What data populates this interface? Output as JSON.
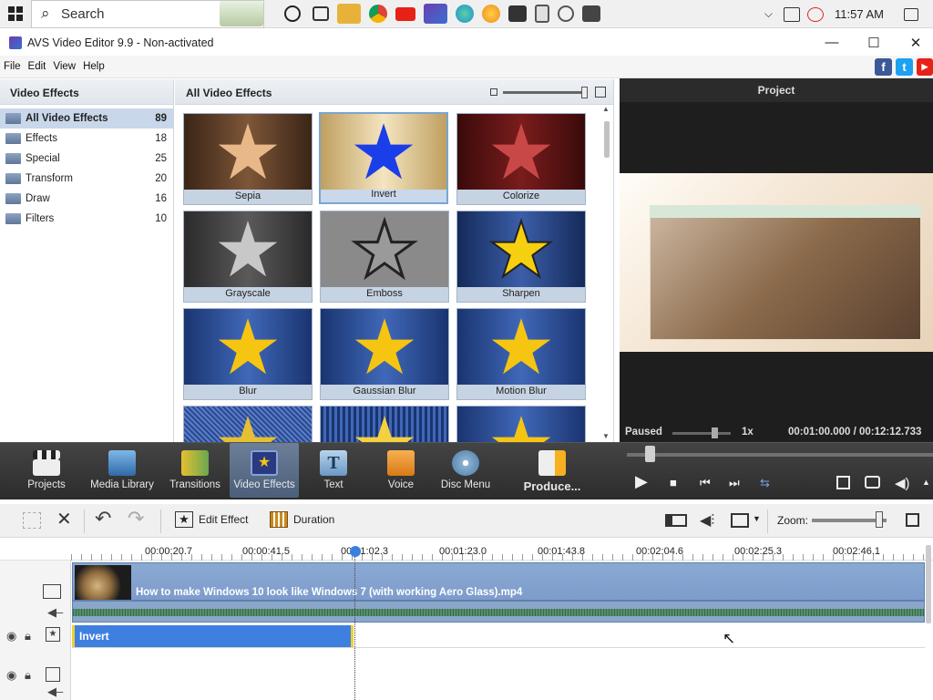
{
  "taskbar": {
    "search_placeholder": "Search",
    "time": "11:57 AM",
    "colors": {
      "youtube": "#e62117",
      "chrome": "#e9b21d",
      "edge": "#1f8fd8",
      "firefox": "#f08a24"
    }
  },
  "window": {
    "title": "AVS Video Editor 9.9 - Non-activated",
    "minimize": "—",
    "maximize": "☐",
    "close": "✕"
  },
  "menu": [
    "File",
    "Edit",
    "View",
    "Help"
  ],
  "social": {
    "facebook": "f",
    "twitter": "t",
    "youtube": "▶"
  },
  "categories": {
    "header": "Video Effects",
    "items": [
      {
        "label": "All Video Effects",
        "count": "89"
      },
      {
        "label": "Effects",
        "count": "18"
      },
      {
        "label": "Special",
        "count": "25"
      },
      {
        "label": "Transform",
        "count": "20"
      },
      {
        "label": "Draw",
        "count": "16"
      },
      {
        "label": "Filters",
        "count": "10"
      }
    ]
  },
  "grid": {
    "header": "All Video Effects",
    "tiles": [
      {
        "label": "Sepia"
      },
      {
        "label": "Invert"
      },
      {
        "label": "Colorize"
      },
      {
        "label": "Grayscale"
      },
      {
        "label": "Emboss"
      },
      {
        "label": "Sharpen"
      },
      {
        "label": "Blur"
      },
      {
        "label": "Gaussian Blur"
      },
      {
        "label": "Motion Blur"
      },
      {
        "label": ""
      },
      {
        "label": ""
      },
      {
        "label": ""
      }
    ]
  },
  "project": {
    "header": "Project",
    "status": "Paused",
    "speed": "1x",
    "time": "00:01:00.000 / 00:12:12.733"
  },
  "tools": {
    "projects": "Projects",
    "media_library": "Media Library",
    "transitions": "Transitions",
    "video_effects": "Video Effects",
    "text": "Text",
    "voice": "Voice",
    "disc_menu": "Disc Menu",
    "produce": "Produce..."
  },
  "playback": {
    "play": "▶",
    "stop": "■",
    "prev": "⏮",
    "next": "⏭",
    "mark": "⇆"
  },
  "timeline_tools": {
    "edit_effect": "Edit Effect",
    "duration": "Duration",
    "zoom": "Zoom:"
  },
  "ruler": [
    "00:00:20.7",
    "00:00:41.5",
    "00:01:02.3",
    "00:01:23.0",
    "00:01:43.8",
    "00:02:04.6",
    "00:02:25.3",
    "00:02:46.1"
  ],
  "tracks": {
    "video_clip": "How to make Windows 10 look like Windows 7 (with working Aero Glass).mp4",
    "effect_clip": "Invert"
  }
}
